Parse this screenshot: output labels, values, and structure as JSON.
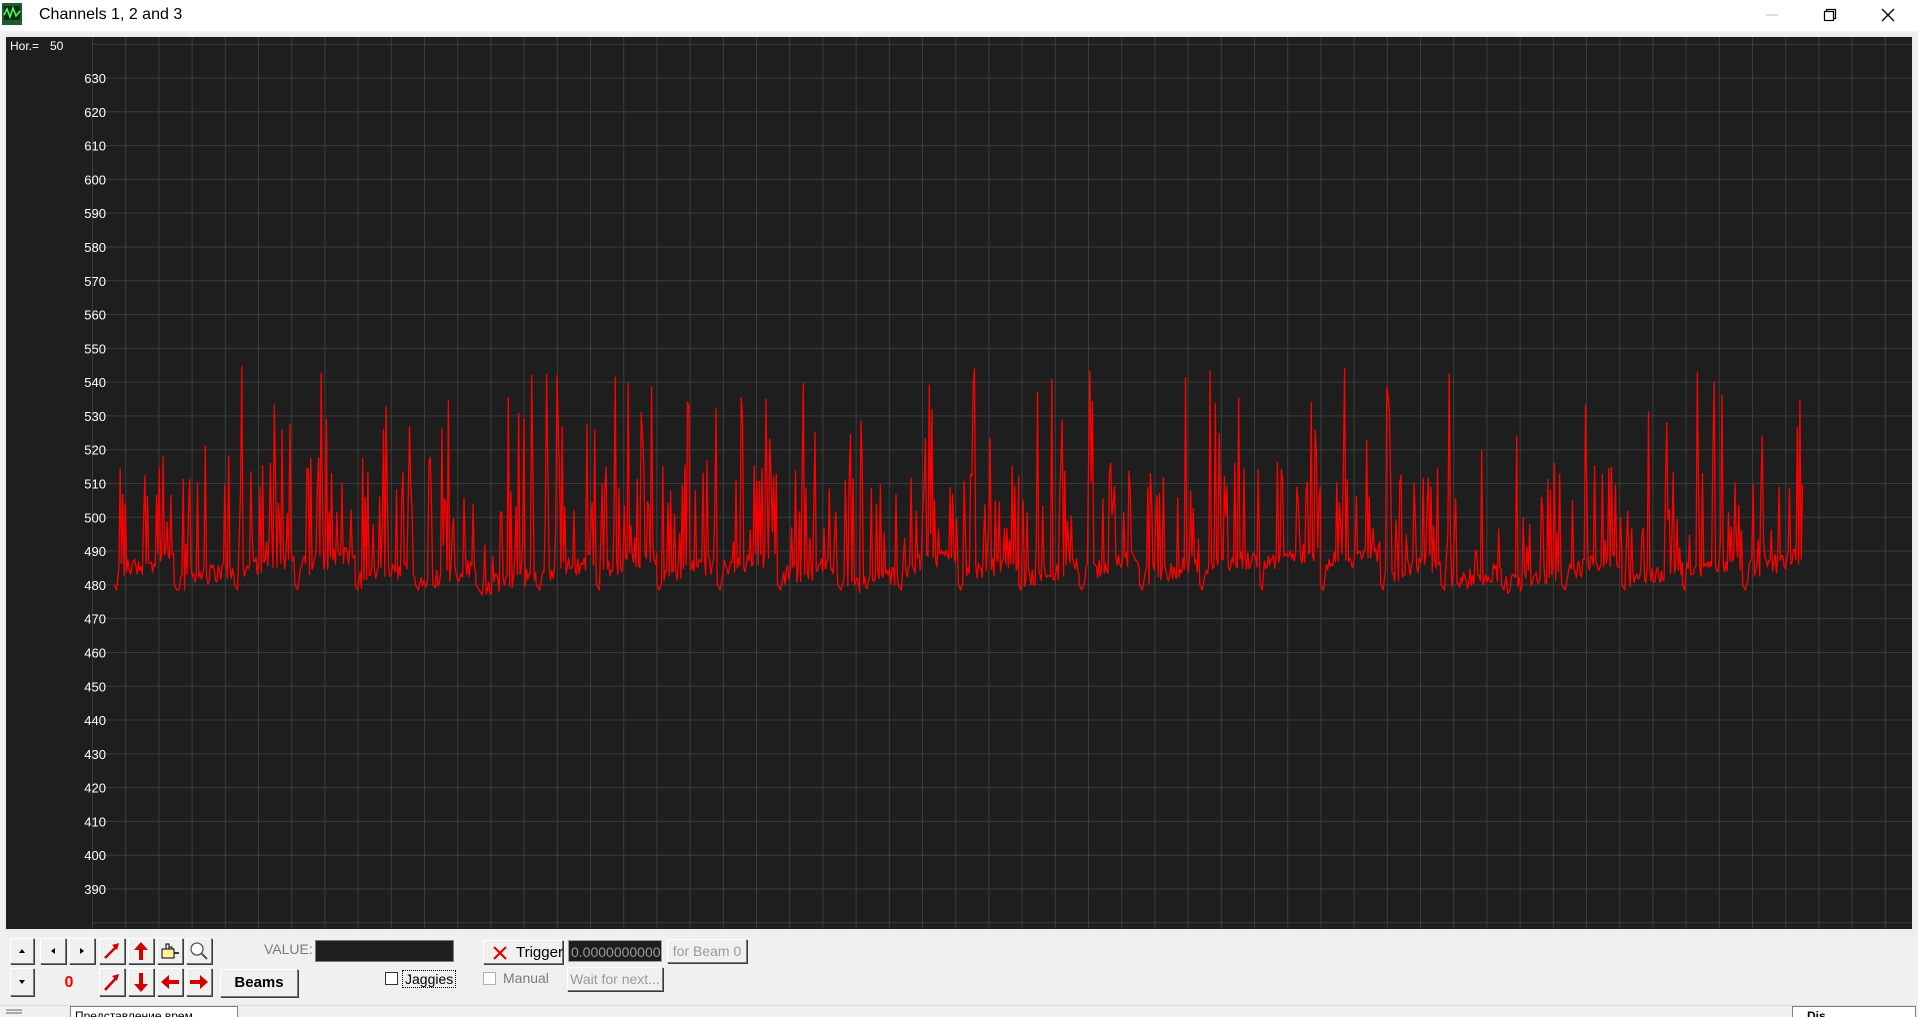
{
  "window": {
    "title": "Channels 1, 2 and 3"
  },
  "chart_header": {
    "hor_label": "Hor.=",
    "hor_value": "50"
  },
  "chart_data": {
    "type": "line",
    "y_ticks": [
      "630",
      "620",
      "610",
      "600",
      "590",
      "580",
      "570",
      "560",
      "550",
      "540",
      "530",
      "520",
      "510",
      "500",
      "490",
      "480",
      "470",
      "460",
      "450",
      "440",
      "430",
      "420",
      "410",
      "400",
      "390"
    ],
    "ylim": [
      380,
      640
    ],
    "grid": true,
    "background": "#1e1e1e",
    "grid_color": "#3c3c3c",
    "line_color": "#ff0000",
    "baseline_range": [
      480,
      492
    ],
    "spike_range": [
      505,
      545
    ],
    "segment_count": 28
  },
  "toolbar": {
    "counter_value": "0",
    "beams_label": "Beams",
    "value_label": "VALUE:",
    "jaggies_label": "Jaggies",
    "trigger_label": "Trigger",
    "trigger_value": "0.0000000000",
    "for_beam_label": "for Beam 0",
    "manual_label": "Manual",
    "wait_label": "Wait for next..."
  },
  "statusbar": {
    "tab_text": "Представление врем",
    "right_text": "Dis"
  },
  "colors": {
    "accent_red": "#ff0000",
    "plot_bg": "#1e1e1e"
  },
  "icons": [
    "app-oscilloscope-icon",
    "minimize-icon",
    "restore-icon",
    "close-icon",
    "arrow-up-small-icon",
    "arrow-left-small-icon",
    "arrow-right-small-icon",
    "arrow-down-small-icon",
    "diagonal-arrow-icon",
    "red-up-arrow-icon",
    "hand-pointer-icon",
    "magnifier-icon",
    "red-down-arrow-icon",
    "red-left-arrow-icon",
    "red-right-arrow-icon",
    "trigger-x-icon"
  ]
}
